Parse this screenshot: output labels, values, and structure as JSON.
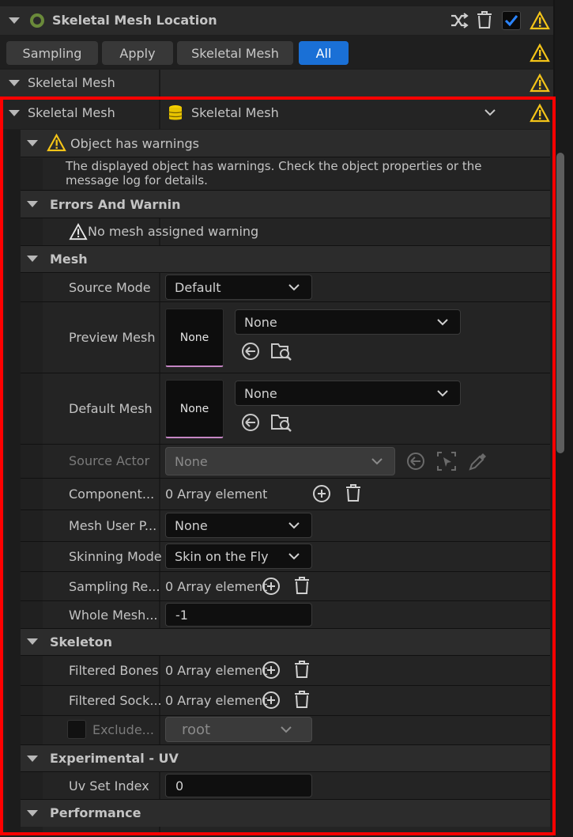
{
  "header": {
    "title": "Skeletal Mesh Location"
  },
  "toolbar": {
    "buttons": [
      "Sampling",
      "Apply",
      "Skeletal Mesh",
      "All"
    ],
    "active": "All"
  },
  "category_row": {
    "label": "Skeletal Mesh"
  },
  "asset_row": {
    "label": "Skeletal Mesh",
    "value": "Skeletal Mesh"
  },
  "warning_section": {
    "title": "Object has warnings",
    "message": "The displayed object has warnings.  Check the object properties or the message log for details."
  },
  "errors_section": {
    "title": "Errors And Warnin",
    "item": "No mesh assigned warning"
  },
  "mesh_section": {
    "title": "Mesh",
    "source_mode": {
      "label": "Source Mode",
      "value": "Default"
    },
    "preview_mesh": {
      "label": "Preview Mesh",
      "thumb": "None",
      "value": "None"
    },
    "default_mesh": {
      "label": "Default Mesh",
      "thumb": "None",
      "value": "None"
    },
    "source_actor": {
      "label": "Source Actor",
      "value": "None"
    },
    "components": {
      "label": "Component...",
      "value": "0 Array element"
    },
    "mesh_user_p": {
      "label": "Mesh User P...",
      "value": "None"
    },
    "skinning_mode": {
      "label": "Skinning Mode",
      "value": "Skin on the Fly"
    },
    "sampling_re": {
      "label": "Sampling Re...",
      "value": "0 Array element"
    },
    "whole_mesh": {
      "label": "Whole Mesh...",
      "value": "-1"
    }
  },
  "skeleton_section": {
    "title": "Skeleton",
    "filtered_bones": {
      "label": "Filtered Bones",
      "value": "0 Array element"
    },
    "filtered_sockets": {
      "label": "Filtered Sock...",
      "value": "0 Array element"
    },
    "exclude": {
      "label": "Exclude...",
      "value": "root"
    }
  },
  "uv_section": {
    "title": "Experimental - UV",
    "uv_set_index": {
      "label": "Uv Set Index",
      "value": "0"
    }
  },
  "performance_section": {
    "title": "Performance"
  },
  "colors": {
    "accent": "#1a70d6",
    "warning": "#f5c518",
    "highlight": "#ff0000",
    "row_bg": "#242424",
    "input_bg": "#0f0f0f"
  }
}
